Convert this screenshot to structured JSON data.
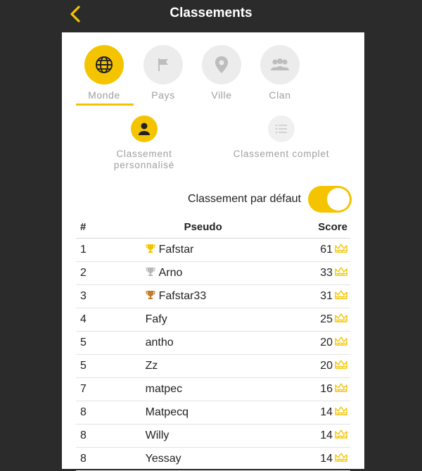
{
  "header": {
    "title": "Classements",
    "back_icon": "chevron-left-icon"
  },
  "colors": {
    "accent": "#f5c400",
    "gold": "#f5c400",
    "silver": "#b8b8b8",
    "bronze": "#c47a2c"
  },
  "scopes": [
    {
      "label": "Monde",
      "icon": "globe-icon",
      "active": true
    },
    {
      "label": "Pays",
      "icon": "flag-icon",
      "active": false
    },
    {
      "label": "Ville",
      "icon": "map-pin-icon",
      "active": false
    },
    {
      "label": "Clan",
      "icon": "group-icon",
      "active": false
    }
  ],
  "modes": [
    {
      "label": "Classement personnalisé",
      "icon": "person-icon",
      "active": true
    },
    {
      "label": "Classement complet",
      "icon": "list-icon",
      "active": false
    }
  ],
  "toggle": {
    "label": "Classement par défaut",
    "on": true
  },
  "table": {
    "headers": {
      "rank": "#",
      "name": "Pseudo",
      "score": "Score"
    },
    "rows": [
      {
        "rank": "1",
        "name": "Fafstar",
        "score": "61",
        "trophy": "gold"
      },
      {
        "rank": "2",
        "name": "Arno",
        "score": "33",
        "trophy": "silver"
      },
      {
        "rank": "3",
        "name": "Fafstar33",
        "score": "31",
        "trophy": "bronze"
      },
      {
        "rank": "4",
        "name": "Fafy",
        "score": "25",
        "trophy": ""
      },
      {
        "rank": "5",
        "name": "antho",
        "score": "20",
        "trophy": ""
      },
      {
        "rank": "5",
        "name": "Zz",
        "score": "20",
        "trophy": ""
      },
      {
        "rank": "7",
        "name": "matpec",
        "score": "16",
        "trophy": ""
      },
      {
        "rank": "8",
        "name": "Matpecq",
        "score": "14",
        "trophy": ""
      },
      {
        "rank": "8",
        "name": "Willy",
        "score": "14",
        "trophy": ""
      },
      {
        "rank": "8",
        "name": "Yessay",
        "score": "14",
        "trophy": ""
      }
    ]
  }
}
